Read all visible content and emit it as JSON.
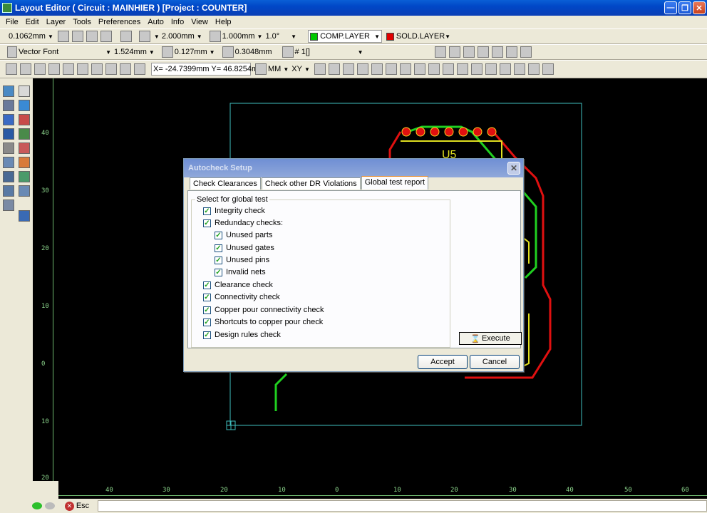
{
  "window": {
    "title": "Layout Editor ( Circuit : MAINHIER ) [Project : COUNTER]"
  },
  "menu": [
    "File",
    "Edit",
    "Layer",
    "Tools",
    "Preferences",
    "Auto",
    "Info",
    "View",
    "Help"
  ],
  "toolbar1": {
    "grid_step": "0.1062mm",
    "grid_size": "2.000mm",
    "snap": "1.000mm",
    "angle": "1.0°",
    "comp_layer": "COMP.LAYER",
    "sold_layer": "SOLD.LAYER",
    "comp_color": "#00c800",
    "sold_color": "#e00000"
  },
  "toolbar2": {
    "font": "Vector Font",
    "text_size": "1.524mm",
    "line_width": "0.127mm",
    "spacing": "0.3048mm",
    "net": "# 1[]"
  },
  "toolbar3": {
    "coords": "X= -24.7399mm  Y= 46.8254mm",
    "mm": "MM",
    "xy": "XY"
  },
  "vruler_labels": [
    "40",
    "30",
    "20",
    "10",
    "0",
    "10",
    "20"
  ],
  "hruler_labels": [
    "40",
    "30",
    "20",
    "10",
    "0",
    "10",
    "20",
    "30",
    "40",
    "50",
    "60"
  ],
  "pcb": {
    "ref_label": "U5",
    "border_color": "#40c0c0"
  },
  "dialog": {
    "title": "Autocheck Setup",
    "tabs": [
      "Check Clearances",
      "Check other DR Violations",
      "Global test report"
    ],
    "group_label": "Select for global test",
    "checks": [
      {
        "label": "Integrity check",
        "checked": true,
        "indent": 0
      },
      {
        "label": "Redundacy checks:",
        "checked": true,
        "indent": 0
      },
      {
        "label": "Unused parts",
        "checked": true,
        "indent": 1
      },
      {
        "label": "Unused gates",
        "checked": true,
        "indent": 1
      },
      {
        "label": "Unused pins",
        "checked": true,
        "indent": 1
      },
      {
        "label": "Invalid nets",
        "checked": true,
        "indent": 1
      },
      {
        "label": "Clearance check",
        "checked": true,
        "indent": 0
      },
      {
        "label": "Connectivity check",
        "checked": true,
        "indent": 0
      },
      {
        "label": "Copper pour connectivity check",
        "checked": true,
        "indent": 0
      },
      {
        "label": "Shortcuts to copper pour check",
        "checked": true,
        "indent": 0
      },
      {
        "label": "Design rules check",
        "checked": true,
        "indent": 0
      }
    ],
    "execute_label": "Execute",
    "accept_label": "Accept",
    "cancel_label": "Cancel"
  },
  "status": {
    "esc_label": "Esc"
  }
}
